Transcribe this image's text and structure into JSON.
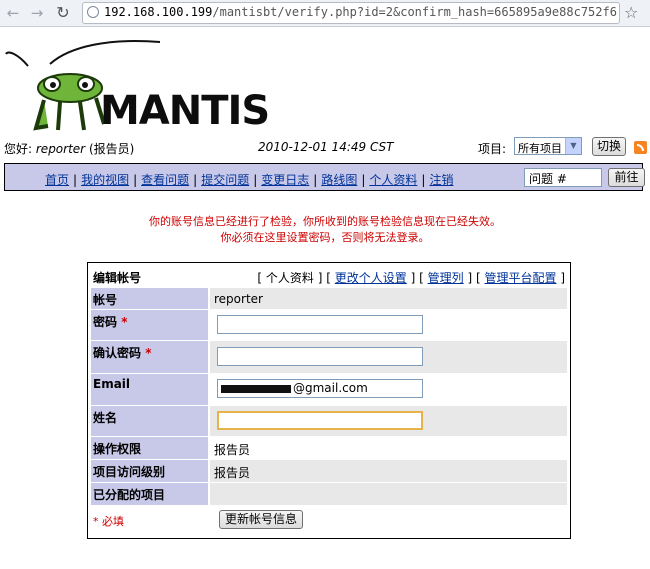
{
  "browser": {
    "url_host": "192.168.100.199",
    "url_path": "/mantisbt/verify.php?id=2&confirm_hash=665895a9e88c752f6"
  },
  "logo": {
    "text": "MANTIS"
  },
  "header": {
    "greeting_prefix": "您好:",
    "username": "reporter",
    "role": "(报告员)",
    "datetime": "2010-12-01 14:49 CST",
    "project_label": "项目:",
    "project_selected": "所有项目",
    "switch_button": "切换"
  },
  "menu": {
    "items": [
      "首页",
      "我的视图",
      "查看问题",
      "提交问题",
      "变更日志",
      "路线图",
      "个人资料",
      "注销"
    ],
    "jump_placeholder": "问题 #",
    "jump_button": "前往"
  },
  "warning": {
    "line1": "你的账号信息已经进行了检验，你所收到的账号检验信息现在已经失效。",
    "line2": "你必须在这里设置密码，否则将无法登录。"
  },
  "form": {
    "title": "编辑帐号",
    "links": {
      "open": "[",
      "profile": "个人资料",
      "sep1": "] [",
      "change_prefs": "更改个人设置",
      "sep2": "] [",
      "manage_columns": "管理列",
      "sep3": "] [",
      "manage_profiles": "管理平台配置",
      "close": "]"
    },
    "username_label": "帐号",
    "username_value": "reporter",
    "password_label": "密码",
    "confirm_password_label": "确认密码",
    "required_star": "*",
    "email_label": "Email",
    "email_value_visible": "@gmail.com",
    "realname_label": "姓名",
    "access_level_label": "操作权限",
    "access_level_value": "报告员",
    "project_access_label": "项目访问级别",
    "project_access_value": "报告员",
    "assigned_projects_label": "已分配的项目",
    "required_note": "* 必填",
    "update_button": "更新帐号信息"
  }
}
